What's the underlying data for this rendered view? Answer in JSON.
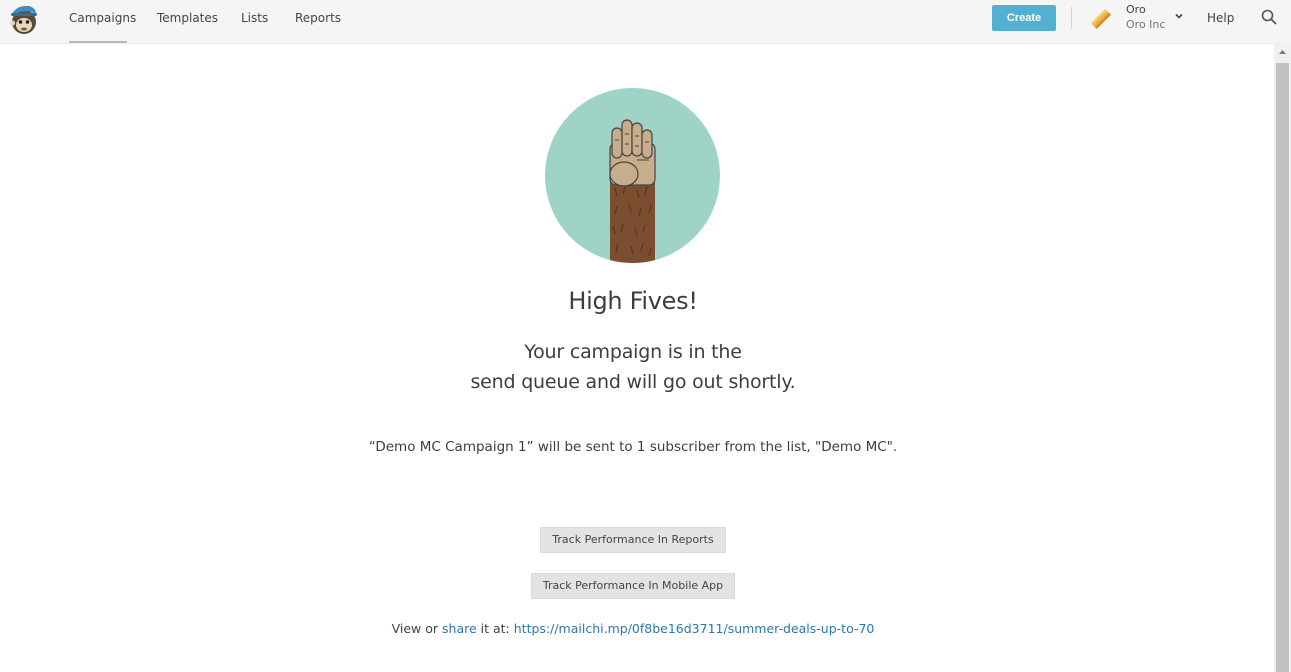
{
  "nav": {
    "items": [
      {
        "label": "Campaigns",
        "active": true
      },
      {
        "label": "Templates",
        "active": false
      },
      {
        "label": "Lists",
        "active": false
      },
      {
        "label": "Reports",
        "active": false
      }
    ],
    "create_label": "Create",
    "account": {
      "name": "Oro",
      "org": "Oro Inc"
    },
    "help_label": "Help"
  },
  "main": {
    "title": "High Fives!",
    "subtitle_line1": "Your campaign is in the",
    "subtitle_line2": "send queue and will go out shortly.",
    "detail": "“Demo MC Campaign 1” will be sent to 1 subscriber from the list, \"Demo MC\".",
    "track_reports_label": "Track Performance In Reports",
    "track_mobile_label": "Track Performance In Mobile App",
    "share": {
      "prefix": "View or ",
      "share_link": "share",
      "middle": " it at: ",
      "url": "https://mailchi.mp/0f8be16d3711/summer-deals-up-to-70"
    }
  },
  "colors": {
    "accent": "#52b1d2",
    "hero_circle": "#9fd3c7",
    "link": "#2a7aa8",
    "button_bg": "#e3e3e3"
  },
  "icons": {
    "logo": "mailchimp-freddie-logo",
    "account": "pencil-stripe-icon",
    "chevron": "chevron-down-icon",
    "search": "search-icon",
    "hero": "high-five-hand-illustration"
  }
}
